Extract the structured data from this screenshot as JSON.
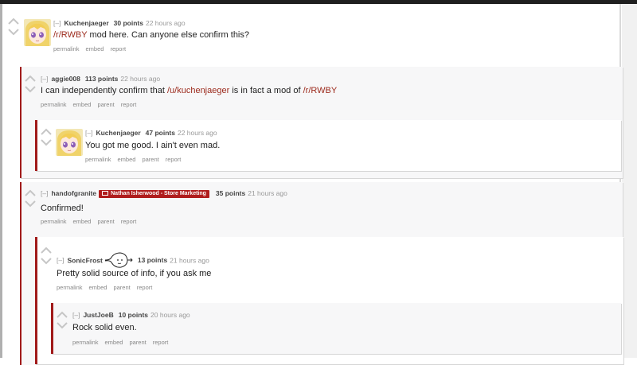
{
  "comments": [
    {
      "toggle": "[–]",
      "author": "Kuchenjaeger",
      "score": "30 points",
      "time": "22 hours ago",
      "body_link": "/r/RWBY",
      "body_text": " mod here. Can anyone else confirm this?",
      "buttons": [
        "permalink",
        "embed",
        "report"
      ]
    },
    {
      "toggle": "[–]",
      "author": "aggie008",
      "score": "113 points",
      "time": "22 hours ago",
      "body_pre": "I can independently confirm that ",
      "body_link1": "/u/kuchenjaeger",
      "body_mid": " is in fact a mod of ",
      "body_link2": "/r/RWBY",
      "buttons": [
        "permalink",
        "embed",
        "parent",
        "report"
      ]
    },
    {
      "toggle": "[–]",
      "author": "Kuchenjaeger",
      "score": "47 points",
      "time": "22 hours ago",
      "body_text": "You got me good. I ain't even mad.",
      "buttons": [
        "permalink",
        "embed",
        "parent",
        "report"
      ]
    },
    {
      "toggle": "[–]",
      "author": "handofgranite",
      "flair": "Nathan Isherwood - Store Marketing",
      "score": "35 points",
      "time": "21 hours ago",
      "body_text": "Confirmed!",
      "buttons": [
        "permalink",
        "embed",
        "parent",
        "report"
      ]
    },
    {
      "toggle": "[–]",
      "author": "SonicFrost",
      "score": "13 points",
      "time": "21 hours ago",
      "body_text": "Pretty solid source of info, if you ask me",
      "buttons": [
        "permalink",
        "embed",
        "parent",
        "report"
      ]
    },
    {
      "toggle": "[–]",
      "author": "JustJoeB",
      "score": "10 points",
      "time": "20 hours ago",
      "body_text": "Rock solid even.",
      "buttons": [
        "permalink",
        "embed",
        "parent",
        "report"
      ]
    }
  ],
  "icons": {
    "upvote": "upvote-arrow-icon",
    "downvote": "downvote-arrow-icon",
    "avatar": "anime-girl-avatar",
    "flair_icon": "tv-icon",
    "user_flair": "squiggle-face-icon"
  },
  "colors": {
    "accent": "#a11a1a",
    "link": "#9c2a1c",
    "flair_bg": "#b01d1d",
    "thread_bg": "#f7f7f8"
  }
}
